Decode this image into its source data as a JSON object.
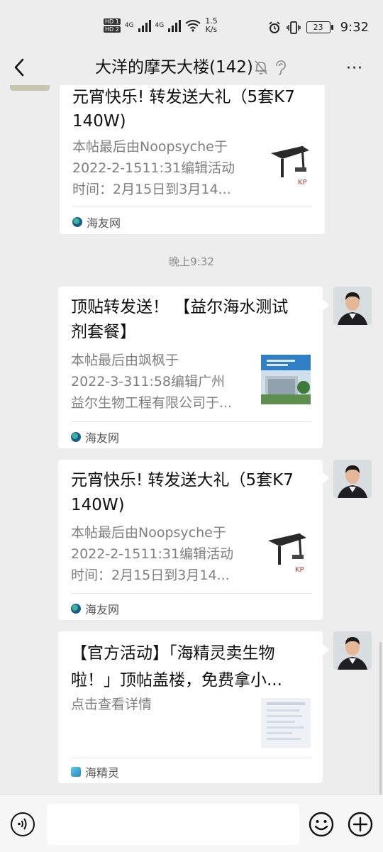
{
  "status_bar": {
    "sim1": "HD 1",
    "sim2": "HD 2",
    "net1": "4G",
    "net2": "4G",
    "speed_value": "1.5",
    "speed_unit": "K/s",
    "battery": "23",
    "time": "9:32"
  },
  "header": {
    "title": "大洋的摩天大楼(142)",
    "more": "···"
  },
  "messages": {
    "card1": {
      "title_line1": "元宵快乐! 转发送大礼（5套K7",
      "title_line2": "140W)",
      "desc_line1": "本帖最后由Noopsyche于",
      "desc_line2": "2022-2-1511:31编辑活动",
      "desc_line3": "时间：2月15日到3月14...",
      "source": "海友网"
    },
    "timestamp": "晚上9:32",
    "card2": {
      "title_line1": "顶贴转发送！ 【益尔海水测试",
      "title_line2": "剂套餐】",
      "desc_line1": "本帖最后由飒枫于",
      "desc_line2": "2022-3-311:58编辑广州",
      "desc_line3": "益尔生物工程有限公司于...",
      "source": "海友网"
    },
    "card3": {
      "title_line1": "元宵快乐! 转发送大礼（5套K7",
      "title_line2": "140W)",
      "desc_line1": "本帖最后由Noopsyche于",
      "desc_line2": "2022-2-1511:31编辑活动",
      "desc_line3": "时间：2月15日到3月14...",
      "source": "海友网"
    },
    "card4": {
      "title_line1": "【官方活动】「海精灵卖生物",
      "title_line2": "啦！」顶帖盖楼，免费拿小...",
      "desc_line1": "点击查看详情",
      "source": "海精灵"
    }
  },
  "input": {
    "placeholder": ""
  },
  "colors": {
    "background": "#ededed",
    "card": "#ffffff",
    "timestamp": "#8a8a8a"
  }
}
